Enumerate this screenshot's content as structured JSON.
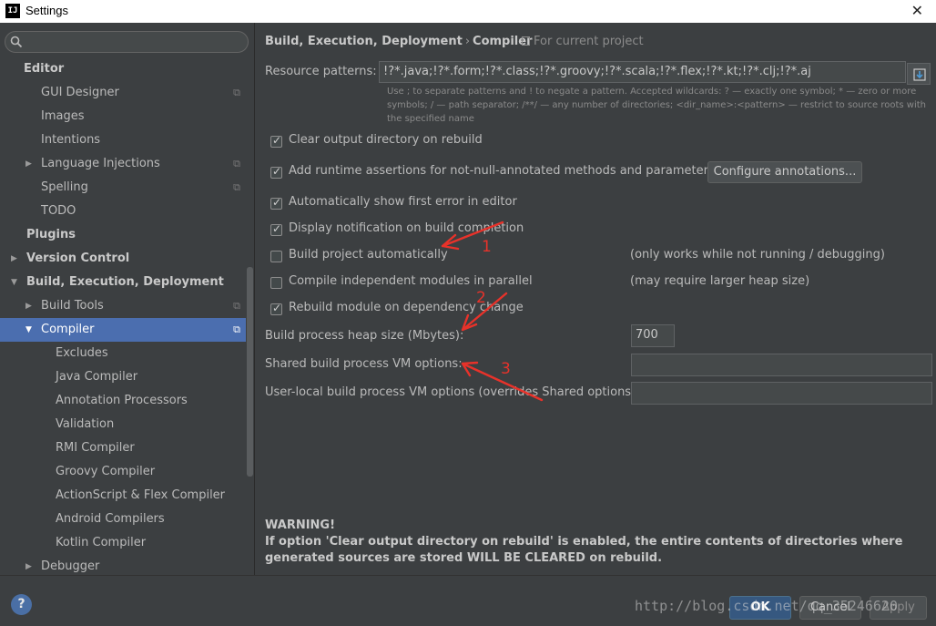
{
  "window": {
    "title": "Settings",
    "logo_text": "IJ",
    "close_glyph": "✕"
  },
  "sidebar": {
    "search_placeholder": "",
    "items": [
      {
        "label": "Editor",
        "level": 0,
        "bold": true,
        "arrow": "",
        "project": false
      },
      {
        "label": "GUI Designer",
        "level": 1,
        "bold": false,
        "arrow": "",
        "project": true
      },
      {
        "label": "Images",
        "level": 1,
        "bold": false,
        "arrow": "",
        "project": false
      },
      {
        "label": "Intentions",
        "level": 1,
        "bold": false,
        "arrow": "",
        "project": false
      },
      {
        "label": "Language Injections",
        "level": 1,
        "bold": false,
        "arrow": "▶",
        "project": true
      },
      {
        "label": "Spelling",
        "level": 1,
        "bold": false,
        "arrow": "",
        "project": true
      },
      {
        "label": "TODO",
        "level": 1,
        "bold": false,
        "arrow": "",
        "project": false
      },
      {
        "label": "Plugins",
        "level": 0,
        "bold": true,
        "arrow": "",
        "project": false
      },
      {
        "label": "Version Control",
        "level": 0,
        "bold": true,
        "arrow": "▶",
        "project": false
      },
      {
        "label": "Build, Execution, Deployment",
        "level": 0,
        "bold": true,
        "arrow": "▼",
        "project": false
      },
      {
        "label": "Build Tools",
        "level": 1,
        "bold": false,
        "arrow": "▶",
        "project": true
      },
      {
        "label": "Compiler",
        "level": 1,
        "bold": false,
        "arrow": "▼",
        "project": true,
        "selected": true
      },
      {
        "label": "Excludes",
        "level": 2,
        "bold": false,
        "arrow": "",
        "project": false
      },
      {
        "label": "Java Compiler",
        "level": 2,
        "bold": false,
        "arrow": "",
        "project": false
      },
      {
        "label": "Annotation Processors",
        "level": 2,
        "bold": false,
        "arrow": "",
        "project": false
      },
      {
        "label": "Validation",
        "level": 2,
        "bold": false,
        "arrow": "",
        "project": false
      },
      {
        "label": "RMI Compiler",
        "level": 2,
        "bold": false,
        "arrow": "",
        "project": false
      },
      {
        "label": "Groovy Compiler",
        "level": 2,
        "bold": false,
        "arrow": "",
        "project": false
      },
      {
        "label": "ActionScript & Flex Compiler",
        "level": 2,
        "bold": false,
        "arrow": "",
        "project": false
      },
      {
        "label": "Android Compilers",
        "level": 2,
        "bold": false,
        "arrow": "",
        "project": false
      },
      {
        "label": "Kotlin Compiler",
        "level": 2,
        "bold": false,
        "arrow": "",
        "project": false
      },
      {
        "label": "Debugger",
        "level": 1,
        "bold": false,
        "arrow": "▶",
        "project": false
      }
    ]
  },
  "breadcrumb": {
    "parent": "Build, Execution, Deployment",
    "separator": "›",
    "current": "Compiler",
    "scope": "For current project"
  },
  "resource_patterns": {
    "label": "Resource patterns:",
    "value": "!?*.java;!?*.form;!?*.class;!?*.groovy;!?*.scala;!?*.flex;!?*.kt;!?*.clj;!?*.aj",
    "hint": "Use ; to separate patterns and ! to negate a pattern. Accepted wildcards: ? — exactly one symbol; * — zero or more symbols; / — path separator; /**/ — any number of directories; <dir_name>:<pattern> — restrict to source roots with the specified name"
  },
  "options": {
    "clear_output": {
      "label": "Clear output directory on rebuild",
      "checked": true
    },
    "runtime_assertions": {
      "label": "Add runtime assertions for not-null-annotated methods and parameters",
      "checked": true
    },
    "configure_annotations": "Configure annotations...",
    "show_first_error": {
      "label": "Automatically show first error in editor",
      "checked": true
    },
    "display_notification": {
      "label": "Display notification on build completion",
      "checked": true
    },
    "build_automatically": {
      "label": "Build project automatically",
      "checked": false,
      "note": "(only works while not running / debugging)"
    },
    "compile_parallel": {
      "label": "Compile independent modules in parallel",
      "checked": false,
      "note": "(may require larger heap size)"
    },
    "rebuild_on_change": {
      "label": "Rebuild module on dependency change",
      "checked": true
    }
  },
  "fields": {
    "heap_size": {
      "label": "Build process heap size (Mbytes):",
      "value": "700"
    },
    "shared_vm": {
      "label": "Shared build process VM options:",
      "value": ""
    },
    "user_vm": {
      "label": "User-local build process VM options (overrides Shared options):",
      "value": ""
    }
  },
  "warning": {
    "title": "WARNING!",
    "text": "If option 'Clear output directory on rebuild' is enabled, the entire contents of directories where generated sources are stored WILL BE CLEARED on rebuild."
  },
  "annotations": {
    "color": "#e8322a",
    "labels": [
      "1",
      "2",
      "3"
    ]
  },
  "footer": {
    "help": "?",
    "ok": "OK",
    "cancel": "Cancel",
    "apply": "Apply",
    "watermark": "http://blog.csdn.net/qq_35246620"
  }
}
